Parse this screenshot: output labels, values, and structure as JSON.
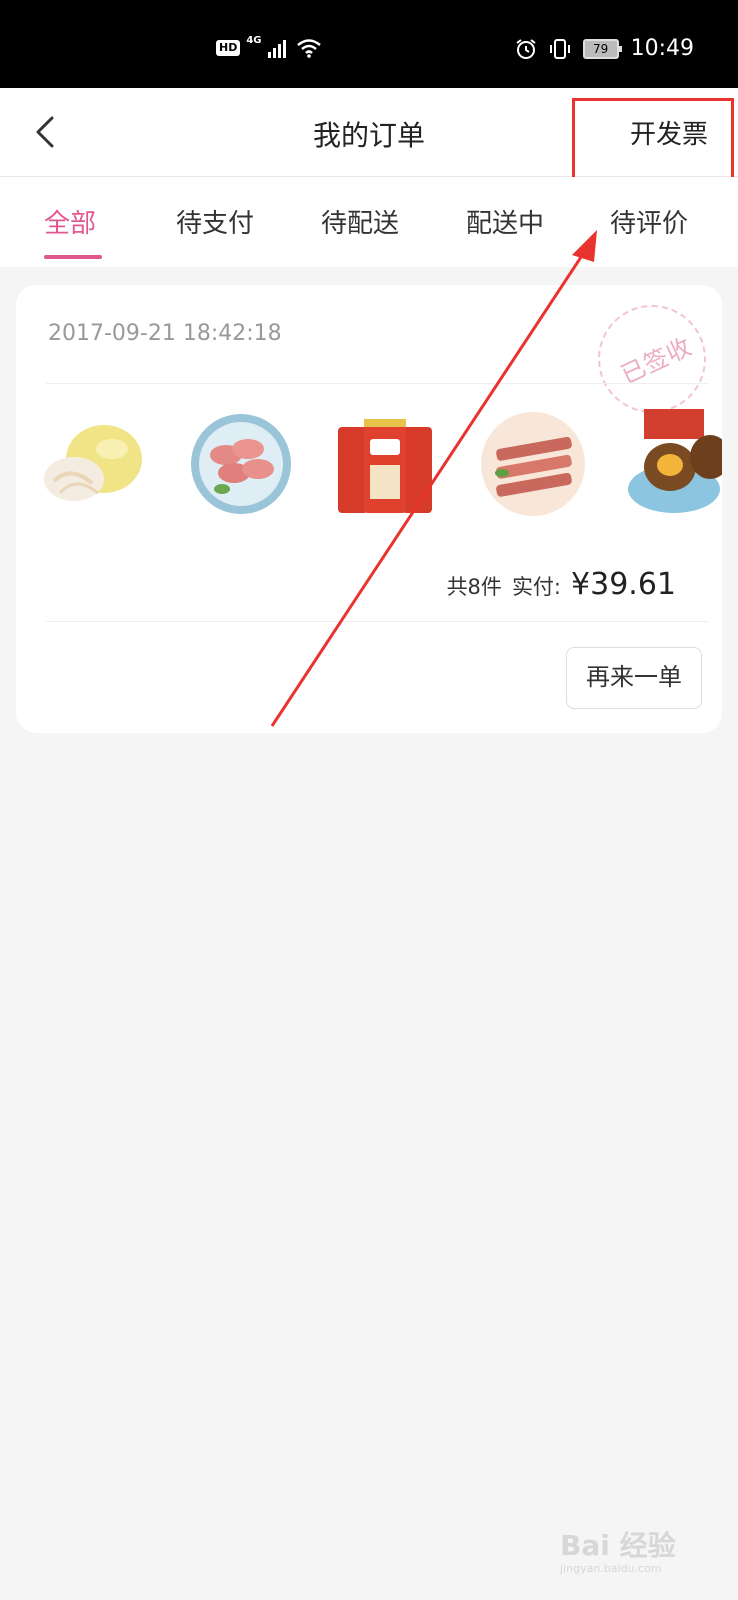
{
  "status_bar": {
    "hd": "HD",
    "network": "4G",
    "battery": "79",
    "time": "10:49",
    "icons": [
      "signal-icon",
      "wifi-icon",
      "alarm-icon",
      "vibrate-icon",
      "battery-icon"
    ]
  },
  "header": {
    "title": "我的订单",
    "action": "开发票",
    "back_icon": "chevron-left-icon"
  },
  "tabs": [
    {
      "label": "全部",
      "active": true
    },
    {
      "label": "待支付",
      "active": false
    },
    {
      "label": "待配送",
      "active": false
    },
    {
      "label": "配送中",
      "active": false
    },
    {
      "label": "待评价",
      "active": false
    }
  ],
  "order": {
    "time": "2017-09-21 18:42:18",
    "stamp": "已签收",
    "count": "共8件",
    "paid_label": "实付:",
    "price": "¥39.61",
    "reorder": "再来一单",
    "thumbs": [
      "pomelo-image",
      "sliced-ham-image",
      "canned-congee-image",
      "pork-belly-image",
      "braised-egg-image"
    ]
  },
  "watermark": {
    "text": "Bai 经验",
    "sub": "jingyan.baidu.com"
  },
  "colors": {
    "accent": "#e0588f",
    "annotation": "#e8332f"
  }
}
